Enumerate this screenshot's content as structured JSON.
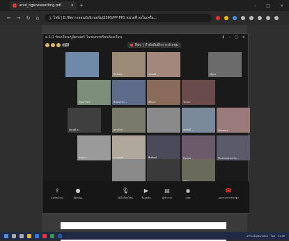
{
  "browser": {
    "tab_title": "ucsd_ngenewsetting.pdf",
    "address_prefix": "ไฟล์",
    "url": "E:/ฟิลการสอนกับนิวนอร์ม/2565/PP-PP1 หน่วยที่ ลงในเครื่อ..."
  },
  "meeting": {
    "title": "ม.1/1 ห้องเรียน-บูลิศาสตร์ ในช่องบทเรียนห้องเรียน",
    "recording_label": "Rec | กำลังบันทึกการประชุม",
    "participant_count": "+23",
    "participants": [
      {
        "name": "",
        "bg": "#6f8aa8"
      },
      {
        "name": "ปิยวัฒน์ ...",
        "bg": "#9b8a76"
      },
      {
        "name": "ธนพงศ์ ...",
        "bg": "#a3877c"
      },
      {
        "name": "ณัฐพร",
        "bg": "#6b6b6b"
      },
      {
        "name": "กัญญารัตน์",
        "bg": "#7c8f7a"
      },
      {
        "name": "ธีรพงษ์ ชา...",
        "bg": "#5f6b8a"
      },
      {
        "name": "ศิรินภา",
        "bg": "#8a6b5a"
      },
      {
        "name": "วิภาดา",
        "bg": "#6a4b4b"
      },
      {
        "name": "ณัฐวุฒิ อ...",
        "bg": "#3f3f3f"
      },
      {
        "name": "สุดารัตน์",
        "bg": "#7a7a6a"
      },
      {
        "name": "",
        "bg": "#8a8a8a"
      },
      {
        "name": "สมศักดิ์ ...",
        "bg": "#7a8a9a"
      },
      {
        "name": "Chanida",
        "bg": "#9a7a7a"
      },
      {
        "name": "นันทนา",
        "bg": "#9a9a9a"
      },
      {
        "name": "ภาณุพงศ์",
        "bg": "#b0a89a"
      },
      {
        "name": "พีรพัฒน์",
        "bg": "#4a4a5a"
      },
      {
        "name": "Pawee...",
        "bg": "#6a5a6a"
      },
      {
        "name": "Phumniphat Sa...",
        "bg": "#5a5a6a"
      },
      {
        "name": "",
        "bg": "#8a8a8a"
      },
      {
        "name": "",
        "bg": "#3a3a3a"
      },
      {
        "name": "สุวิมล ...",
        "bg": "#6a6a5a"
      }
    ],
    "toolbar": {
      "share": "แชร์หน้าจอ",
      "camera": "ปิดกล้อง",
      "mic": "ปิดไมโครโฟน",
      "reactions": "รีแอคชัน",
      "participants": "ผู้เข้าร่วม",
      "chat": "แชท",
      "leave": "ออกจากการประชุม"
    }
  },
  "taskbar": {
    "weather": "29°C มีเมฆบางส่วน",
    "language": "ไทย",
    "time": "11:36"
  },
  "colors": {
    "accent": "#e33333",
    "taskbar": "#1f2a44"
  }
}
